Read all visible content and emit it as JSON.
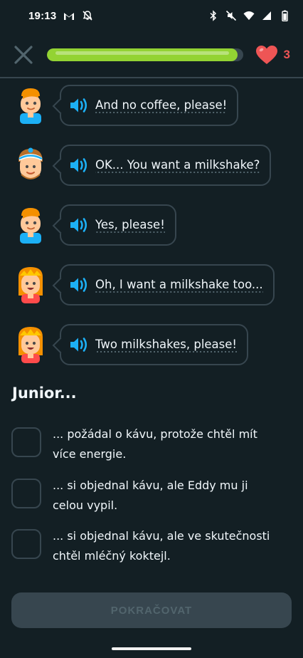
{
  "status_bar": {
    "time": "19:13",
    "icons": [
      "gmail-icon",
      "notifications-off-icon",
      "bluetooth-icon",
      "vibrate-mute-icon",
      "wifi-icon",
      "signal-icon",
      "battery-icon"
    ]
  },
  "top_bar": {
    "close_icon": "close-icon",
    "progress_fraction": 0.97,
    "progress_color": "#93d333",
    "hearts_count": "3",
    "heart_color": "#ee5555"
  },
  "dialogue": [
    {
      "speaker": "junior",
      "text": "And no coffee, please!"
    },
    {
      "speaker": "eddy",
      "text": "OK... You want a milkshake?"
    },
    {
      "speaker": "junior",
      "text": "Yes, please!"
    },
    {
      "speaker": "lily",
      "text": "Oh, I want a milkshake too..."
    },
    {
      "speaker": "lily",
      "text": "Two milkshakes, please!"
    }
  ],
  "question": {
    "title": "Junior...",
    "options": [
      {
        "line1": "... požádal o kávu, protože chtěl mít",
        "line2": "více energie."
      },
      {
        "line1": "... si objednal kávu, ale Eddy mu ji",
        "line2": "celou vypil."
      },
      {
        "line1": "... si objednal kávu, ale ve skutečnosti",
        "line2": "chtěl mléčný koktejl."
      }
    ]
  },
  "continue_label": "POKRAČOVAT",
  "colors": {
    "background": "#131f24",
    "border": "#37464f",
    "speaker": "#1cb0f6",
    "disabled_text": "#52656d"
  }
}
